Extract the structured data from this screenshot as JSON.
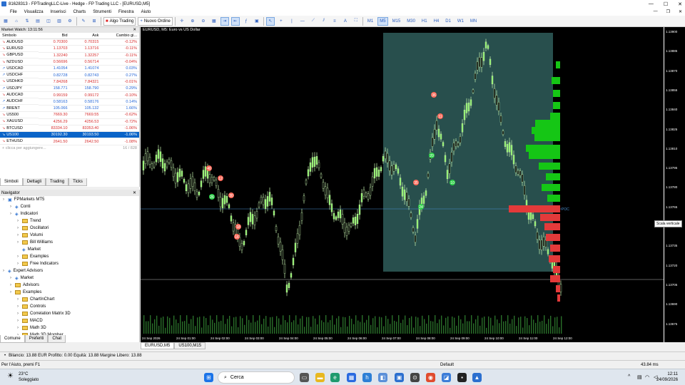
{
  "window": {
    "title": "81628313 - FPTradingLLC-Live - Hedge - FP Trading LLC - [EURUSD,M5]"
  },
  "menu": {
    "items": [
      "File",
      "Visualizza",
      "Inserisci",
      "Charts",
      "Strumenti",
      "Finestra",
      "Aiuto"
    ]
  },
  "toolbar": {
    "algo_label": "Algo Trading",
    "order_label": "Nuovo Ordine",
    "timeframes": [
      "M1",
      "M5",
      "M15",
      "M30",
      "H1",
      "H4",
      "D1",
      "W1",
      "MN"
    ],
    "selected_tf": "M5"
  },
  "market_watch": {
    "title": "Market Watch: 13:11:56",
    "columns": [
      "Simbolo",
      "Bid",
      "Ask",
      "Cambio gi..."
    ],
    "rows": [
      {
        "s": "AUDUSD",
        "bid": "0.70300",
        "ask": "0.70315",
        "ch": "-0.12%",
        "d": "dn"
      },
      {
        "s": "EURUSD",
        "bid": "1.13703",
        "ask": "1.13716",
        "ch": "-0.11%",
        "d": "dn"
      },
      {
        "s": "GBPUSD",
        "bid": "1.32240",
        "ask": "1.32257",
        "ch": "-0.11%",
        "d": "dn"
      },
      {
        "s": "NZDUSD",
        "bid": "0.56696",
        "ask": "0.56714",
        "ch": "-0.04%",
        "d": "dn"
      },
      {
        "s": "USDCAD",
        "bid": "1.41054",
        "ask": "1.41074",
        "ch": "0.03%",
        "d": "up"
      },
      {
        "s": "USDCHF",
        "bid": "0.82728",
        "ask": "0.82743",
        "ch": "0.27%",
        "d": "up"
      },
      {
        "s": "USDHKD",
        "bid": "7.84268",
        "ask": "7.84321",
        "ch": "-0.01%",
        "d": "dn"
      },
      {
        "s": "USDJPY",
        "bid": "158.771",
        "ask": "158.790",
        "ch": "0.29%",
        "d": "up"
      },
      {
        "s": "AUDCAD",
        "bid": "0.99159",
        "ask": "0.99172",
        "ch": "-0.10%",
        "d": "dn"
      },
      {
        "s": "AUDCHF",
        "bid": "0.58163",
        "ask": "0.58176",
        "ch": "0.14%",
        "d": "up"
      },
      {
        "s": "BRENT",
        "bid": "105.066",
        "ask": "105.132",
        "ch": "1.66%",
        "d": "up"
      },
      {
        "s": "US500",
        "bid": "7669.30",
        "ask": "7669.55",
        "ch": "-0.62%",
        "d": "dn"
      },
      {
        "s": "XAUUSD",
        "bid": "4256.29",
        "ask": "4256.53",
        "ch": "-0.72%",
        "d": "dn"
      },
      {
        "s": "BTCUSD",
        "bid": "83334.10",
        "ask": "83353.40",
        "ch": "-1.06%",
        "d": "dn"
      },
      {
        "s": "US100",
        "bid": "30192.30",
        "ask": "30193.50",
        "ch": "-1.06%",
        "d": "dn",
        "sel": true
      },
      {
        "s": "ETHUSD",
        "bid": "2641.50",
        "ask": "2642.50",
        "ch": "-1.08%",
        "d": "dn"
      }
    ],
    "add_placeholder": "+ clicca per aggiungere...",
    "count": "16 / 828",
    "tabs": [
      "Simboli",
      "Dettagli",
      "Trading",
      "Ticks"
    ]
  },
  "navigator": {
    "title": "Navigator",
    "items": [
      {
        "l": "FPMarkets MT5",
        "lvl": 0,
        "t": "root"
      },
      {
        "l": "Conti",
        "lvl": 1,
        "t": "item"
      },
      {
        "l": "Indicatori",
        "lvl": 1,
        "t": "item"
      },
      {
        "l": "Trend",
        "lvl": 2,
        "t": "folder"
      },
      {
        "l": "Oscillatori",
        "lvl": 2,
        "t": "folder"
      },
      {
        "l": "Volumi",
        "lvl": 2,
        "t": "folder"
      },
      {
        "l": "Bill Williams",
        "lvl": 2,
        "t": "folder"
      },
      {
        "l": "Market",
        "lvl": 2,
        "t": "item"
      },
      {
        "l": "Examples",
        "lvl": 2,
        "t": "folder"
      },
      {
        "l": "Free Indicators",
        "lvl": 2,
        "t": "folder"
      },
      {
        "l": "Expert Advisors",
        "lvl": 0,
        "t": "item"
      },
      {
        "l": "Market",
        "lvl": 1,
        "t": "item"
      },
      {
        "l": "Advisors",
        "lvl": 1,
        "t": "folder"
      },
      {
        "l": "Examples",
        "lvl": 1,
        "t": "folder"
      },
      {
        "l": "ChartInChart",
        "lvl": 2,
        "t": "folder"
      },
      {
        "l": "Controls",
        "lvl": 2,
        "t": "folder"
      },
      {
        "l": "Correlation Matrix 3D",
        "lvl": 2,
        "t": "folder"
      },
      {
        "l": "MACD",
        "lvl": 2,
        "t": "folder"
      },
      {
        "l": "Math 3D",
        "lvl": 2,
        "t": "folder"
      },
      {
        "l": "Math 3D Morpher",
        "lvl": 2,
        "t": "folder"
      }
    ],
    "tabs": [
      "Comune",
      "Preferiti",
      "Chat"
    ]
  },
  "chart": {
    "symbol_label": "EURUSD, M5:  Euro vs US Dollar",
    "poc_label": "POC",
    "scale_btn": "Scala verticale",
    "y_ticks": [
      "1.13900",
      "1.13885",
      "1.13870",
      "1.13855",
      "1.13840",
      "1.13825",
      "1.13810",
      "1.13795",
      "1.13780",
      "1.13765",
      "1.13750",
      "1.13735",
      "1.13720",
      "1.13705",
      "1.13690",
      "1.13675",
      "1.13660"
    ],
    "x_ticks": [
      "24 Sep 2026",
      "24 Sep 01:00",
      "24 Sep 02:00",
      "24 Sep 03:00",
      "24 Sep 04:00",
      "24 Sep 05:00",
      "24 Sep 06:00",
      "24 Sep 07:00",
      "24 Sep 08:00",
      "24 Sep 09:00",
      "24 Sep 10:00",
      "24 Sep 11:00",
      "24 Sep 12:00"
    ],
    "tabs": [
      "EURUSD,M5",
      "US100,M15"
    ],
    "bubbles": [
      [
        "40",
        "r"
      ],
      [
        "12",
        "r"
      ],
      [
        "30",
        "r"
      ],
      [
        "26",
        "g"
      ],
      [
        "16",
        "r"
      ],
      [
        "18",
        "r"
      ],
      [
        "20",
        "g"
      ],
      [
        "11",
        "r"
      ],
      [
        "10",
        "g"
      ],
      [
        "36",
        "r"
      ],
      [
        "24",
        "g"
      ],
      [
        "35",
        "r"
      ]
    ]
  },
  "account": {
    "text": "Bilancio: 13.88 EUR  Profitto: 0.00  Equità: 13.88  Margine Libero: 13.88"
  },
  "status": {
    "help": "Per l'Aiuto, premi F1",
    "profile": "Default",
    "ping": "43.84 ms"
  },
  "taskbar": {
    "weather_temp": "23°C",
    "weather_desc": "Soleggiato",
    "search": "Cerca",
    "time": "12:11",
    "date": "24/09/2026"
  }
}
